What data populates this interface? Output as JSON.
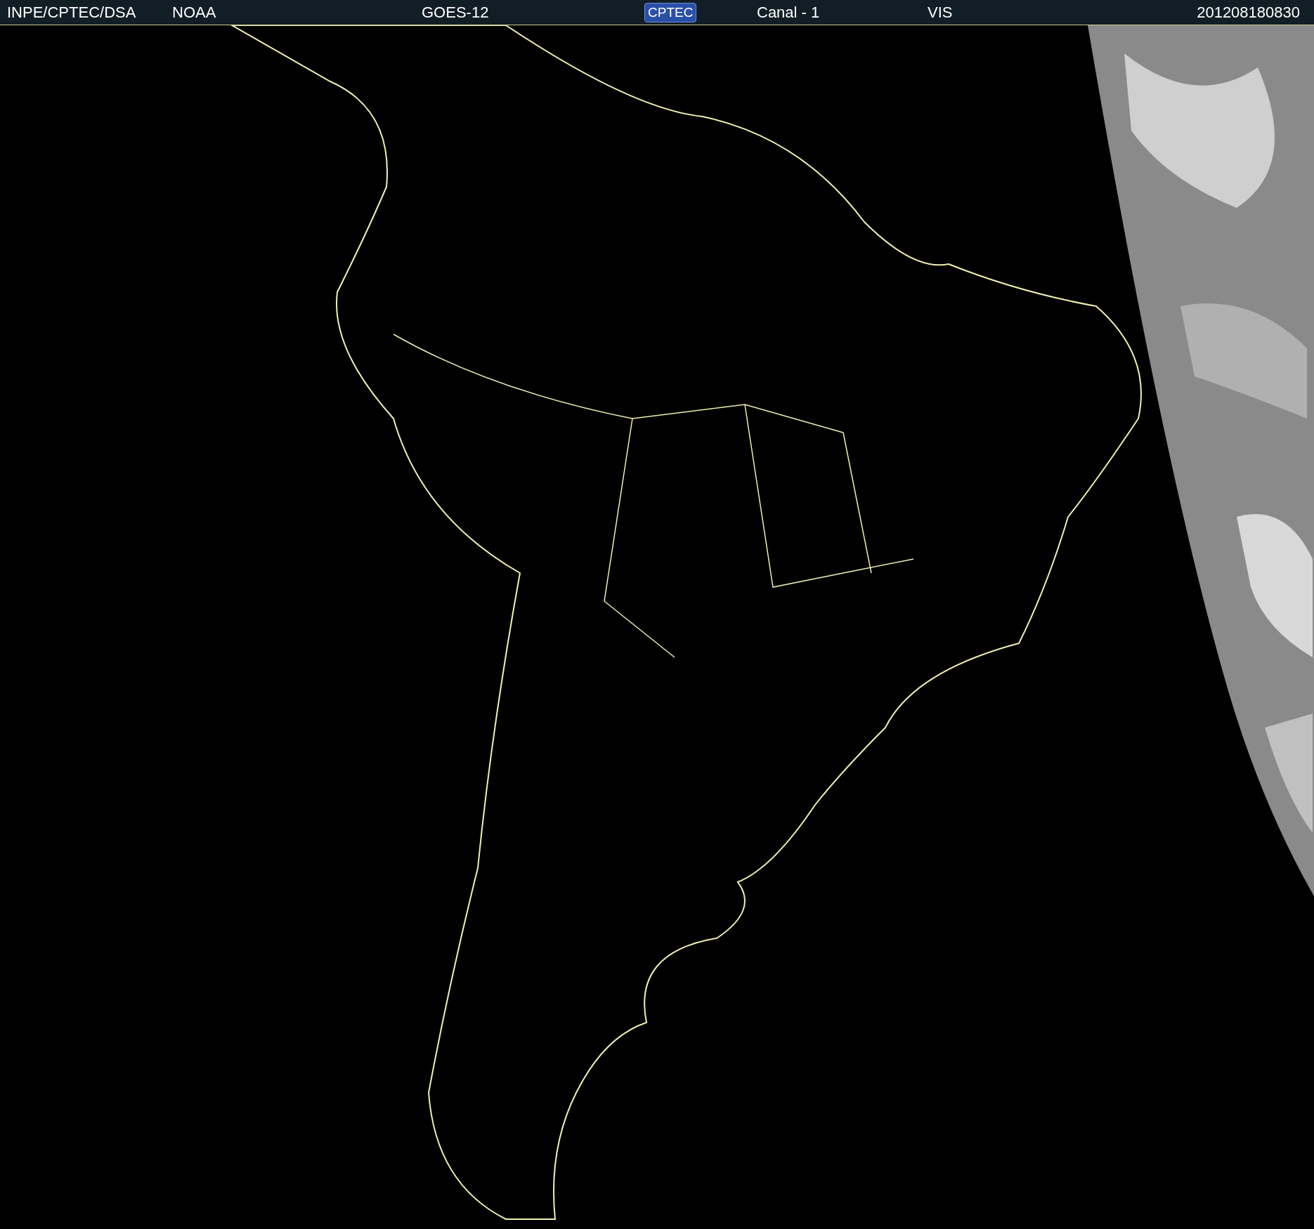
{
  "header": {
    "items": [
      {
        "kind": "text",
        "text": "INPE/CPTEC/DSA"
      },
      {
        "kind": "text",
        "text": "NOAA"
      },
      {
        "kind": "text",
        "text": "GOES-12"
      },
      {
        "kind": "logo",
        "text": "CPTEC"
      },
      {
        "kind": "text",
        "text": "Canal - 1"
      },
      {
        "kind": "text",
        "text": "VIS"
      },
      {
        "kind": "text",
        "text": "201208180830"
      }
    ]
  }
}
